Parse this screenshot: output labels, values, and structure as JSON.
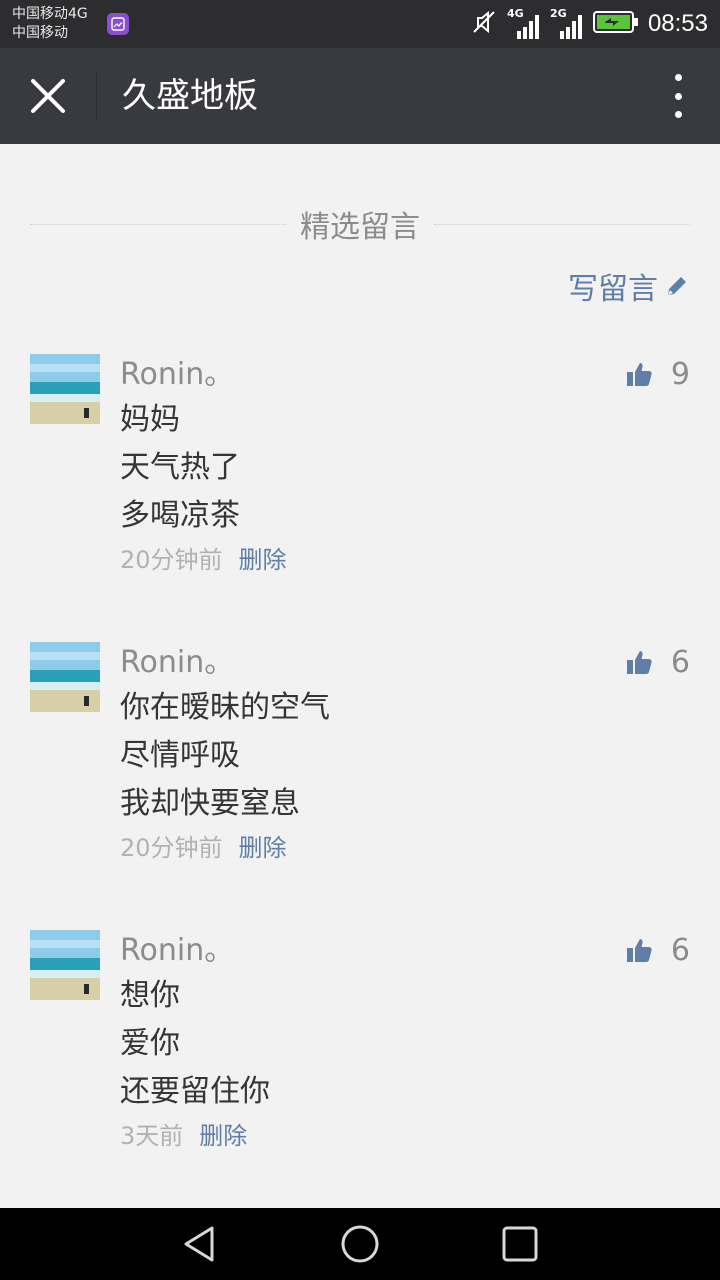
{
  "status_bar": {
    "carrier_line1": "中国移动4G",
    "carrier_line2": "中国移动",
    "net1": "4G",
    "net2": "2G",
    "time": "08:53",
    "battery_color": "#5ac53a"
  },
  "app_bar": {
    "title": "久盛地板"
  },
  "section": {
    "title": "精选留言",
    "write_label": "写留言",
    "accent": "#607fa6"
  },
  "comments": [
    {
      "author": "Ronin。",
      "lines": [
        "妈妈",
        "天气热了",
        "多喝凉茶"
      ],
      "time": "20分钟前",
      "delete_label": "删除",
      "likes": "9"
    },
    {
      "author": "Ronin。",
      "lines": [
        "你在暧昧的空气",
        "尽情呼吸",
        "我却快要窒息"
      ],
      "time": "20分钟前",
      "delete_label": "删除",
      "likes": "6"
    },
    {
      "author": "Ronin。",
      "lines": [
        "想你",
        "爱你",
        "还要留住你"
      ],
      "time": "3天前",
      "delete_label": "删除",
      "likes": "6"
    }
  ]
}
